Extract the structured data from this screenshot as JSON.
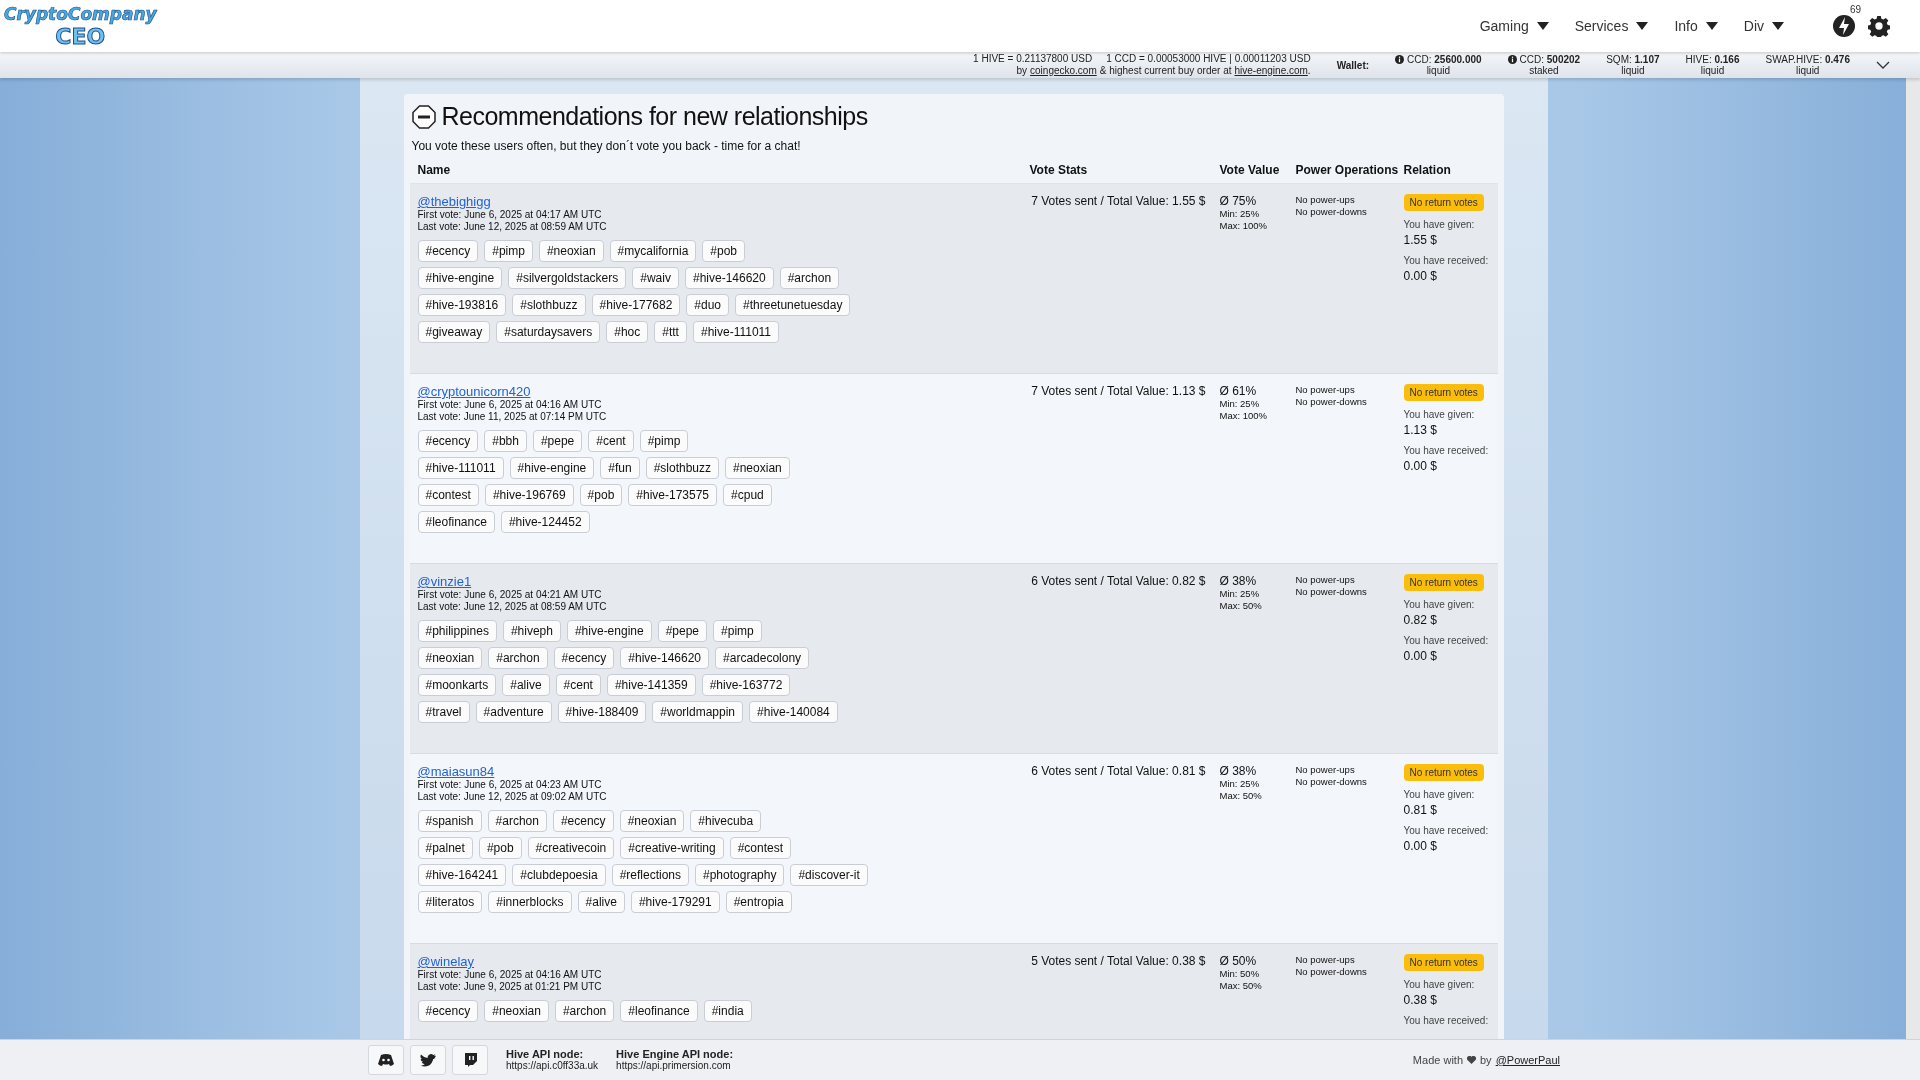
{
  "header": {
    "logo_top": "CryptoCompany",
    "logo_bottom": "CEO",
    "nav": [
      {
        "label": "Gaming"
      },
      {
        "label": "Services"
      },
      {
        "label": "Info"
      },
      {
        "label": "Div"
      }
    ],
    "notification_count": "69"
  },
  "ticker": {
    "rate_hive": "1 HIVE = 0.21137800 USD",
    "rate_ccd": "1 CCD = 0.00053000 HIVE | 0.00011203 USD",
    "source_prefix": "by",
    "source_link": "coingecko.com",
    "source_middle": "& highest current buy order at",
    "source_link2": "hive-engine.com",
    "source_end": ".",
    "wallet_label": "Wallet:",
    "wallet": [
      {
        "label": "CCD:",
        "value": "25600.000",
        "sub": "liquid",
        "kind": "info"
      },
      {
        "label": "CCD:",
        "value": "500202",
        "sub": "staked",
        "kind": "info"
      },
      {
        "label": "SQM:",
        "value": "1.107",
        "sub": "liquid",
        "kind": "plain"
      },
      {
        "label": "HIVE:",
        "value": "0.166",
        "sub": "liquid",
        "kind": "plain"
      },
      {
        "label": "SWAP.HIVE:",
        "value": "0.476",
        "sub": "liquid",
        "kind": "plain"
      }
    ]
  },
  "card": {
    "title": "Recommendations for new relationships",
    "subtitle": "You vote these users often, but they don´t vote you back - time for a chat!",
    "columns": [
      "Name",
      "Vote Stats",
      "Vote Value",
      "Power Operations",
      "Relation"
    ],
    "rows": [
      {
        "user": "@thebighigg",
        "first_vote": "First vote: June 6, 2025 at 04:17 AM UTC",
        "last_vote": "Last vote: June 12, 2025 at 08:59 AM UTC",
        "tag_lines": [
          [
            "#ecency",
            "#pimp",
            "#neoxian",
            "#mycalifornia",
            "#pob"
          ],
          [
            "#hive-engine",
            "#silvergoldstackers",
            "#waiv",
            "#hive-146620",
            "#archon"
          ],
          [
            "#hive-193816",
            "#slothbuzz",
            "#hive-177682",
            "#duo",
            "#threetunetuesday"
          ],
          [
            "#giveaway",
            "#saturdaysavers",
            "#hoc",
            "#ttt",
            "#hive-111011"
          ]
        ],
        "vote_stats": "7 Votes sent / Total Value: 1.55 $",
        "avg": "Ø 75%",
        "min": "Min: 25%",
        "max": "Max: 100%",
        "power_ups": "No power-ups",
        "power_downs": "No power-downs",
        "badge": "No return votes",
        "given_label": "You have given:",
        "given": "1.55 $",
        "received_label": "You have received:",
        "received": "0.00 $"
      },
      {
        "user": "@cryptounicorn420",
        "first_vote": "First vote: June 6, 2025 at 04:16 AM UTC",
        "last_vote": "Last vote: June 11, 2025 at 07:14 PM UTC",
        "tag_lines": [
          [
            "#ecency",
            "#bbh",
            "#pepe",
            "#cent",
            "#pimp"
          ],
          [
            "#hive-111011",
            "#hive-engine",
            "#fun",
            "#slothbuzz",
            "#neoxian"
          ],
          [
            "#contest",
            "#hive-196769",
            "#pob",
            "#hive-173575",
            "#cpud"
          ],
          [
            "#leofinance",
            "#hive-124452"
          ]
        ],
        "vote_stats": "7 Votes sent / Total Value: 1.13 $",
        "avg": "Ø 61%",
        "min": "Min: 25%",
        "max": "Max: 100%",
        "power_ups": "No power-ups",
        "power_downs": "No power-downs",
        "badge": "No return votes",
        "given_label": "You have given:",
        "given": "1.13 $",
        "received_label": "You have received:",
        "received": "0.00 $"
      },
      {
        "user": "@vinzie1",
        "first_vote": "First vote: June 6, 2025 at 04:21 AM UTC",
        "last_vote": "Last vote: June 12, 2025 at 08:59 AM UTC",
        "tag_lines": [
          [
            "#philippines",
            "#hiveph",
            "#hive-engine",
            "#pepe",
            "#pimp"
          ],
          [
            "#neoxian",
            "#archon",
            "#ecency",
            "#hive-146620",
            "#arcadecolony"
          ],
          [
            "#moonkarts",
            "#alive",
            "#cent",
            "#hive-141359",
            "#hive-163772"
          ],
          [
            "#travel",
            "#adventure",
            "#hive-188409",
            "#worldmappin",
            "#hive-140084"
          ]
        ],
        "vote_stats": "6 Votes sent / Total Value: 0.82 $",
        "avg": "Ø 38%",
        "min": "Min: 25%",
        "max": "Max: 50%",
        "power_ups": "No power-ups",
        "power_downs": "No power-downs",
        "badge": "No return votes",
        "given_label": "You have given:",
        "given": "0.82 $",
        "received_label": "You have received:",
        "received": "0.00 $"
      },
      {
        "user": "@maiasun84",
        "first_vote": "First vote: June 6, 2025 at 04:23 AM UTC",
        "last_vote": "Last vote: June 12, 2025 at 09:02 AM UTC",
        "tag_lines": [
          [
            "#spanish",
            "#archon",
            "#ecency",
            "#neoxian",
            "#hivecuba"
          ],
          [
            "#palnet",
            "#pob",
            "#creativecoin",
            "#creative-writing",
            "#contest"
          ],
          [
            "#hive-164241",
            "#clubdepoesia",
            "#reflections",
            "#photography",
            "#discover-it"
          ],
          [
            "#literatos",
            "#innerblocks",
            "#alive",
            "#hive-179291",
            "#entropia"
          ]
        ],
        "vote_stats": "6 Votes sent / Total Value: 0.81 $",
        "avg": "Ø 38%",
        "min": "Min: 25%",
        "max": "Max: 50%",
        "power_ups": "No power-ups",
        "power_downs": "No power-downs",
        "badge": "No return votes",
        "given_label": "You have given:",
        "given": "0.81 $",
        "received_label": "You have received:",
        "received": "0.00 $"
      },
      {
        "user": "@winelay",
        "first_vote": "First vote: June 6, 2025 at 04:16 AM UTC",
        "last_vote": "Last vote: June 9, 2025 at 01:21 PM UTC",
        "tag_lines": [
          [
            "#ecency",
            "#neoxian",
            "#archon",
            "#leofinance",
            "#india"
          ]
        ],
        "vote_stats": "5 Votes sent / Total Value: 0.38 $",
        "avg": "Ø 50%",
        "min": "Min: 50%",
        "max": "Max: 50%",
        "power_ups": "No power-ups",
        "power_downs": "No power-downs",
        "badge": "No return votes",
        "given_label": "You have given:",
        "given": "0.38 $",
        "received_label": "You have received:"
      }
    ]
  },
  "footer": {
    "nodes": [
      {
        "label": "Hive API node:",
        "value": "https://api.c0ff33a.uk"
      },
      {
        "label": "Hive Engine API node:",
        "value": "https://api.primersion.com"
      }
    ],
    "made_with": "Made with",
    "by": "by",
    "author": "@PowerPaul"
  }
}
